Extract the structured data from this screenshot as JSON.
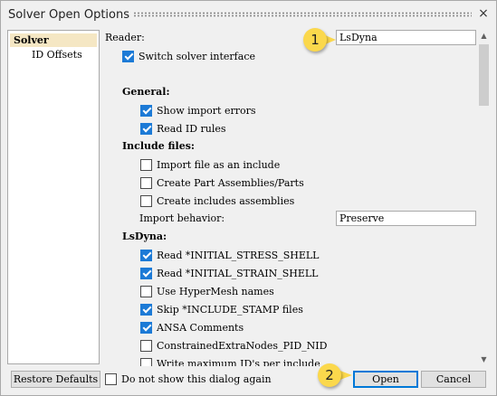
{
  "window": {
    "title": "Solver Open Options",
    "close_icon": "×"
  },
  "tree": {
    "items": [
      {
        "label": "Solver"
      },
      {
        "label": "ID Offsets"
      }
    ]
  },
  "reader": {
    "label": "Reader:",
    "value": "LsDyna"
  },
  "switch_solver": {
    "label": "Switch solver interface",
    "checked": true
  },
  "general": {
    "heading": "General:",
    "show_import_errors": {
      "label": "Show import errors",
      "checked": true
    },
    "read_id_rules": {
      "label": "Read ID rules",
      "checked": true
    }
  },
  "include_files": {
    "heading": "Include files:",
    "import_as_include": {
      "label": "Import file as an include",
      "checked": false
    },
    "create_part_assemblies": {
      "label": "Create Part Assemblies/Parts",
      "checked": false
    },
    "create_includes_assemblies": {
      "label": "Create includes assemblies",
      "checked": false
    },
    "import_behavior_label": "Import behavior:",
    "import_behavior_value": "Preserve"
  },
  "lsdyna": {
    "heading": "LsDyna:",
    "options": [
      {
        "label": "Read *INITIAL_STRESS_SHELL",
        "checked": true
      },
      {
        "label": "Read *INITIAL_STRAIN_SHELL",
        "checked": true
      },
      {
        "label": "Use HyperMesh names",
        "checked": false
      },
      {
        "label": "Skip *INCLUDE_STAMP files",
        "checked": true
      },
      {
        "label": "ANSA Comments",
        "checked": true
      },
      {
        "label": "ConstrainedExtraNodes_PID_NID",
        "checked": false
      },
      {
        "label": "Write maximum ID's per include",
        "checked": false
      }
    ]
  },
  "footer": {
    "restore_defaults": "Restore Defaults",
    "do_not_show": {
      "label": "Do not show this dialog again",
      "checked": false
    },
    "open": "Open",
    "cancel": "Cancel"
  },
  "callouts": [
    {
      "number": "1"
    },
    {
      "number": "2"
    }
  ],
  "colors": {
    "checkbox_checked": "#1c7ad6",
    "tree_selected": "#f5e7c4",
    "callout": "#fbd84c",
    "focus": "#0078d7"
  }
}
